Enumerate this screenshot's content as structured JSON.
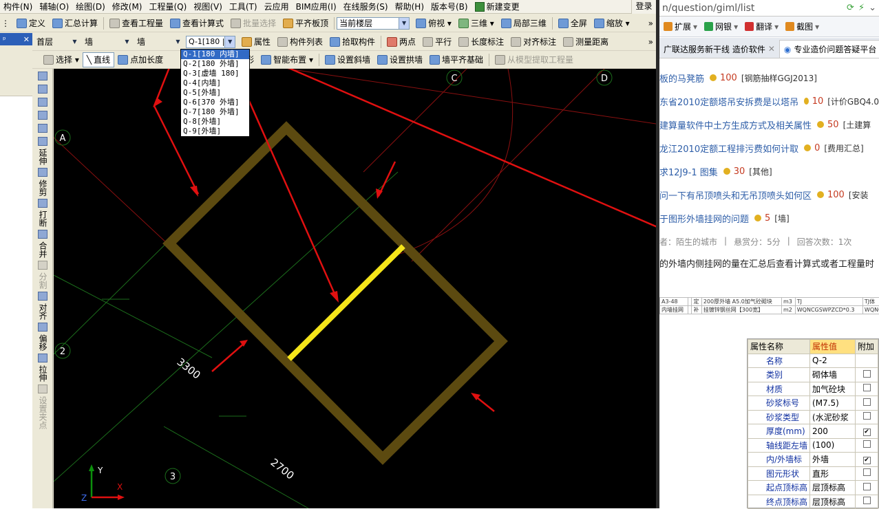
{
  "menu": [
    "构件(N)",
    "辅轴(O)",
    "绘图(D)",
    "修改(M)",
    "工程量(Q)",
    "视图(V)",
    "工具(T)",
    "云应用",
    "BIM应用(I)",
    "在线服务(S)",
    "帮助(H)",
    "版本号(B)"
  ],
  "menu_new_change": "新建变更",
  "login": "登录",
  "toolbar1": {
    "define": "定义",
    "summary": "汇总计算",
    "view_quantity": "查看工程量",
    "view_formula": "查看计算式",
    "batch_select": "批量选择",
    "flat_slab": "平齐板顶",
    "current_floor": "当前楼层",
    "top_view": "俯视",
    "three_d": "三维",
    "local_3d": "局部三维",
    "fullscreen": "全屏",
    "zoom": "缩放"
  },
  "toolbar2": {
    "floor": "首层",
    "type1": "墙",
    "type2": "墙",
    "component": "Q-1[180 |",
    "attribute": "属性",
    "component_list": "构件列表",
    "pick_component": "拾取构件",
    "two_points": "两点",
    "parallel": "平行",
    "length_mark": "长度标注",
    "align_mark": "对齐标注",
    "measure": "测量距离"
  },
  "toolbar3": {
    "select": "选择",
    "line": "直线",
    "point_length": "点加长度",
    "rect": "矩形",
    "smart_layout": "智能布置",
    "set_slope": "设置斜墙",
    "set_arch": "设置拱墙",
    "wall_align": "墙平齐基础",
    "extract": "从模型提取工程量"
  },
  "left_panel_close": "✕",
  "left_panel_pin": "ᵖ",
  "vertical_tools": [
    {
      "name": "extend",
      "label": "延伸",
      "disabled": false
    },
    {
      "name": "trim",
      "label": "修剪",
      "disabled": false
    },
    {
      "name": "break",
      "label": "打断",
      "disabled": false
    },
    {
      "name": "merge",
      "label": "合并",
      "disabled": false
    },
    {
      "name": "split",
      "label": "分割",
      "disabled": true
    },
    {
      "name": "align",
      "label": "对齐",
      "disabled": false
    },
    {
      "name": "offset",
      "label": "偏移",
      "disabled": false
    },
    {
      "name": "stretch",
      "label": "拉伸",
      "disabled": false
    },
    {
      "name": "set-grip",
      "label": "设置夹点",
      "disabled": true
    }
  ],
  "dropdown": {
    "items": [
      "Q-1[180 内墙]",
      "Q-2[180 外墙]",
      "Q-3[虚墙 180]",
      "Q-4[内墙]",
      "Q-5[外墙]",
      "Q-6[370 外墙]",
      "Q-7[180 外墙]",
      "Q-8[外墙]",
      "Q-9[外墙]"
    ],
    "selected_index": 0
  },
  "canvas": {
    "axis_labels": [
      "A",
      "2",
      "3",
      "C",
      "D"
    ],
    "dimensions": [
      "3300",
      "2700"
    ],
    "ucs": {
      "x": "X",
      "y": "Y",
      "z": "Z"
    },
    "colors": {
      "wall": "#5c4a10",
      "selected_wall": "#f5e51a",
      "arrow": "#e01010",
      "grid_red": "#8a1010",
      "grid_green": "#1c6e1c"
    }
  },
  "browser": {
    "url": "n/question/giml/list",
    "toolbar": [
      "扩展",
      "网银",
      "翻译",
      "截图"
    ],
    "tabs": [
      "广联达服务新干线 造价软件",
      "专业造价问题答疑平台"
    ],
    "questions": [
      {
        "title": "板的马凳筋",
        "points": "100",
        "category": "[钢筋抽样GGJ2013]"
      },
      {
        "title": "东省2010定额塔吊安拆费是以塔吊",
        "points": "10",
        "category": "[计价GBQ4.0"
      },
      {
        "title": "建算量软件中土方生成方式及相关属性",
        "points": "50",
        "category": "[土建算"
      },
      {
        "title": "龙江2010定额工程排污费如何计取",
        "points": "0",
        "category": "[费用汇总]"
      },
      {
        "title": "求12J9-1 图集",
        "points": "30",
        "category": "[其他]"
      },
      {
        "title": "问一下有吊顶喷头和无吊顶喷头如何区",
        "points": "100",
        "category": "[安装"
      },
      {
        "title": "于图形外墙挂网的问题",
        "points": "5",
        "category": "[墙]"
      }
    ],
    "meta": [
      "者：陌生的城市",
      "|",
      "悬赏分：5分",
      "|",
      "回答次数：1次"
    ],
    "body": "的外墙内侧挂网的量在汇总后查看计算式或者工程量时",
    "mini_table": [
      [
        "A3-48",
        "",
        "定",
        "200厚外墙 A5.0加气砼砌块",
        "m3",
        "TJ",
        "TJ体"
      ],
      [
        "内墙挂网",
        "",
        "补",
        "挂镀锌钢丝网【300宽】",
        "m2",
        "WQNCGSWPZCD*0.3",
        "WQNC"
      ]
    ]
  },
  "properties": {
    "headers": [
      "属性名称",
      "属性值",
      "附加"
    ],
    "rows": [
      {
        "name": "名称",
        "value": "Q-2",
        "checked": null
      },
      {
        "name": "类别",
        "value": "砌体墙",
        "checked": false
      },
      {
        "name": "材质",
        "value": "加气砼块",
        "checked": false
      },
      {
        "name": "砂浆标号",
        "value": "(M7.5)",
        "checked": false
      },
      {
        "name": "砂浆类型",
        "value": "(水泥砂浆",
        "checked": false
      },
      {
        "name": "厚度(mm)",
        "value": "200",
        "checked": true
      },
      {
        "name": "轴线距左墙",
        "value": "(100)",
        "checked": false
      },
      {
        "name": "内/外墙标",
        "value": "外墙",
        "checked": true
      },
      {
        "name": "图元形状",
        "value": "直形",
        "checked": false
      },
      {
        "name": "起点顶标高",
        "value": "层顶标高",
        "checked": false
      },
      {
        "name": "终点顶标高",
        "value": "层顶标高",
        "checked": false
      }
    ]
  }
}
